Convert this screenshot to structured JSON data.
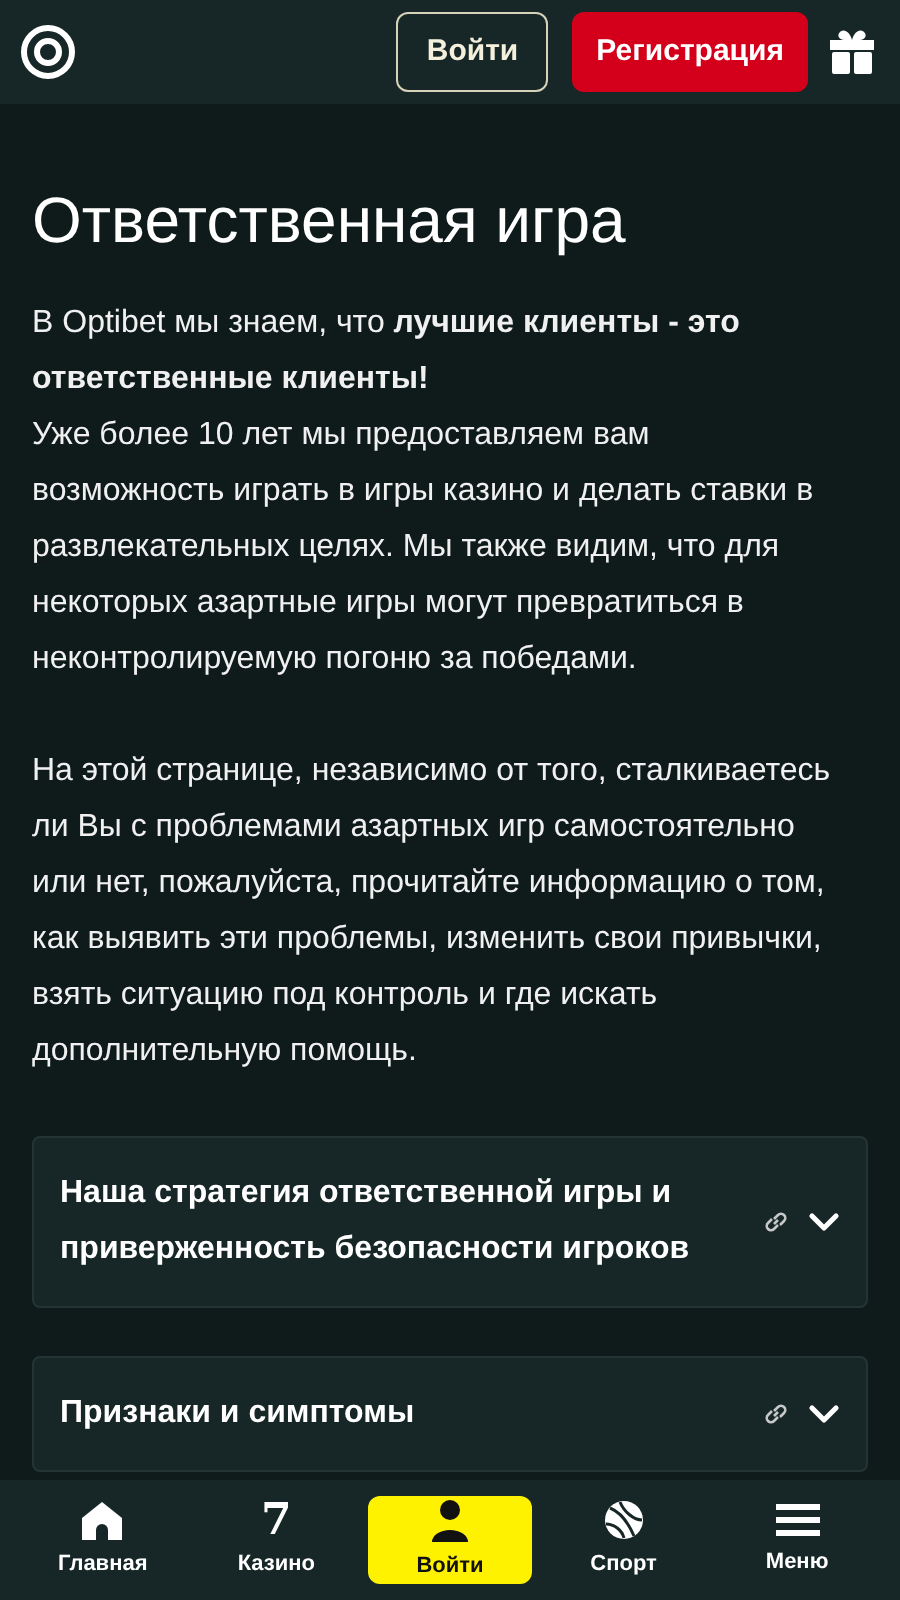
{
  "header": {
    "login_button": "Войти",
    "register_button": "Регистрация"
  },
  "title": "Ответственная игра",
  "paragraphs": [
    "В Optibet мы знаем, что **лучшие клиенты - это ответственные клиенты!**\nУже более 10 лет мы предоставляем вам возможность играть в игры казино и делать ставки в развлекательных целях. Мы также видим, что для некоторых азартные игры могут превратиться в неконтролируемую погоню за победами.",
    "На этой странице, независимо от того, сталкиваетесь ли Вы с проблемами азартных игр самостоятельно или нет, пожалуйста, прочитайте информацию о том, как выявить эти проблемы, изменить свои привычки, взять ситуацию под контроль и где искать дополнительную помощь."
  ],
  "accordion": [
    {
      "title": "Наша стратегия ответственной игры и приверженность безопасности игроков",
      "expanded": false
    },
    {
      "title": "Признаки и симптомы",
      "expanded": false
    }
  ],
  "bottom_nav": [
    {
      "kind": "home",
      "label": "Главная",
      "selected": false
    },
    {
      "kind": "casino",
      "label": "Казино",
      "icon_text": "7",
      "selected": false
    },
    {
      "kind": "login",
      "label": "Войти",
      "selected": true
    },
    {
      "kind": "sport",
      "label": "Спорт",
      "selected": false
    },
    {
      "kind": "menu",
      "label": "Меню",
      "selected": false
    }
  ]
}
